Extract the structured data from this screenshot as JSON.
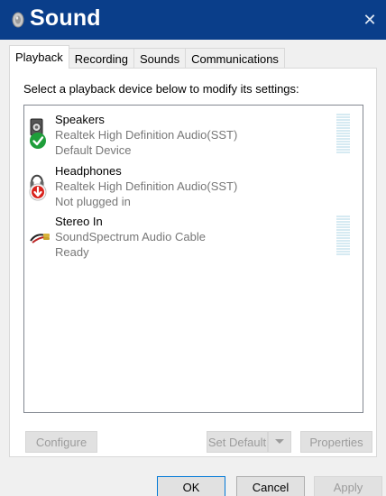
{
  "window": {
    "title": "Sound",
    "title_icon": "speaker-icon",
    "close_glyph": "✕",
    "titlebar_color": "#0a3e8a"
  },
  "tabs": [
    {
      "label": "Playback",
      "active": true
    },
    {
      "label": "Recording",
      "active": false
    },
    {
      "label": "Sounds",
      "active": false
    },
    {
      "label": "Communications",
      "active": false
    }
  ],
  "panel": {
    "instruction": "Select a playback device below to modify its settings:"
  },
  "devices": [
    {
      "name": "Speakers",
      "driver": "Realtek High Definition Audio(SST)",
      "status": "Default Device",
      "icon": "speakers-icon",
      "badge": "green-check-badge-icon",
      "meter": true
    },
    {
      "name": "Headphones",
      "driver": "Realtek High Definition Audio(SST)",
      "status": "Not plugged in",
      "icon": "headphones-icon",
      "badge": "red-down-arrow-badge-icon",
      "meter": false
    },
    {
      "name": "Stereo In",
      "driver": "SoundSpectrum Audio Cable",
      "status": "Ready",
      "icon": "audio-cable-icon",
      "badge": "",
      "meter": true
    }
  ],
  "panel_buttons": {
    "configure": "Configure",
    "set_default": "Set Default",
    "properties": "Properties"
  },
  "dialog_buttons": {
    "ok": "OK",
    "cancel": "Cancel",
    "apply": "Apply"
  }
}
